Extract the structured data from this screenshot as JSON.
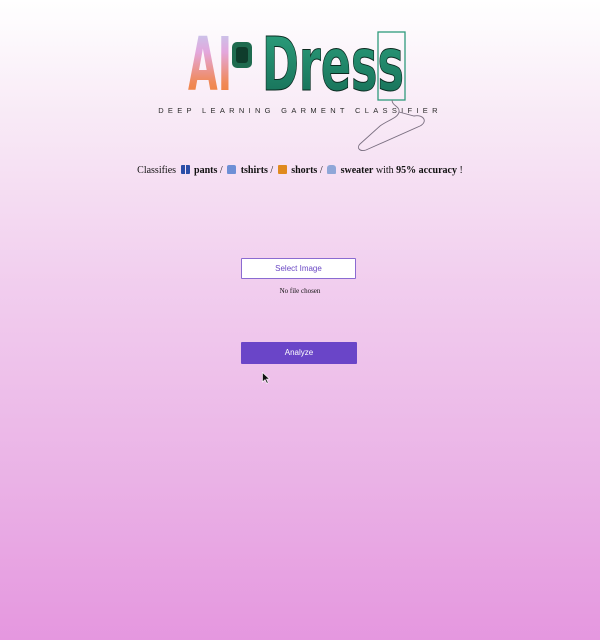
{
  "logo": {
    "part_ai": "AI",
    "part_dress": "Dress",
    "subtitle": "DEEP LEARNING GARMENT CLASSIFIER"
  },
  "tagline": {
    "prefix": "Classifies",
    "items": [
      {
        "label": "pants",
        "icon": "pants-icon"
      },
      {
        "label": "tshirts",
        "icon": "tshirt-icon"
      },
      {
        "label": "shorts",
        "icon": "shorts-icon"
      },
      {
        "label": "sweater",
        "icon": "sweater-icon"
      }
    ],
    "separator": "/",
    "with_text": "with",
    "accuracy": "95% accuracy",
    "suffix": "!"
  },
  "upload": {
    "select_label": "Select Image",
    "status": "No file chosen"
  },
  "actions": {
    "analyze_label": "Analyze"
  },
  "colors": {
    "accent": "#6a45c8",
    "logo_green": "#1f8a6e",
    "gradient_bottom": "#e597df"
  }
}
